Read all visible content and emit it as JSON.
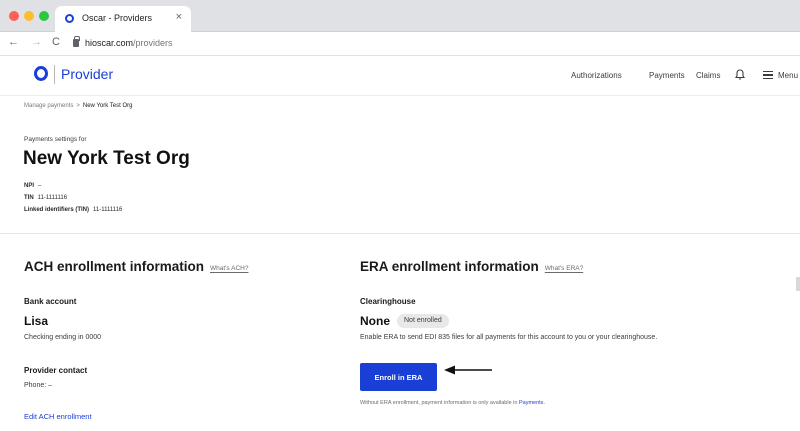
{
  "browser": {
    "tab_title": "Oscar - Providers",
    "tab_close": "×",
    "url_host": "hioscar.com",
    "url_path": "/providers",
    "nav_back": "←",
    "nav_forward": "→",
    "nav_reload": "C"
  },
  "header": {
    "logo_text": "Provider",
    "nav": {
      "authorizations": "Authorizations",
      "payments": "Payments",
      "claims": "Claims",
      "menu": "Menu"
    },
    "brand_color": "#1a3fd6"
  },
  "breadcrumb": {
    "parent": "Manage payments",
    "separator": ">",
    "current": "New York Test Org"
  },
  "page": {
    "settings_label": "Payments settings for",
    "org_name": "New York Test Org",
    "npi_label": "NPI",
    "npi_value": "–",
    "tin_label": "TIN",
    "tin_value": "11-1111116",
    "linked_label": "Linked identifiers (TIN)",
    "linked_value": "11-1111116"
  },
  "ach": {
    "title": "ACH enrollment information",
    "what_link": "What's ACH?",
    "bank_label": "Bank account",
    "bank_name": "Lisa",
    "bank_detail": "Checking ending in 0000",
    "contact_label": "Provider contact",
    "contact_phone": "Phone: –",
    "edit_link": "Edit ACH enrollment"
  },
  "era": {
    "title": "ERA enrollment information",
    "what_link": "What's ERA?",
    "clearinghouse_label": "Clearinghouse",
    "clearinghouse_value": "None",
    "status_badge": "Not enrolled",
    "description": "Enable ERA to send EDI 835 files for all payments for this account to you or your clearinghouse.",
    "enroll_button": "Enroll in ERA",
    "note_prefix": "Without ERA enrollment, payment information is only available in ",
    "note_link": "Payments",
    "note_suffix": "."
  }
}
